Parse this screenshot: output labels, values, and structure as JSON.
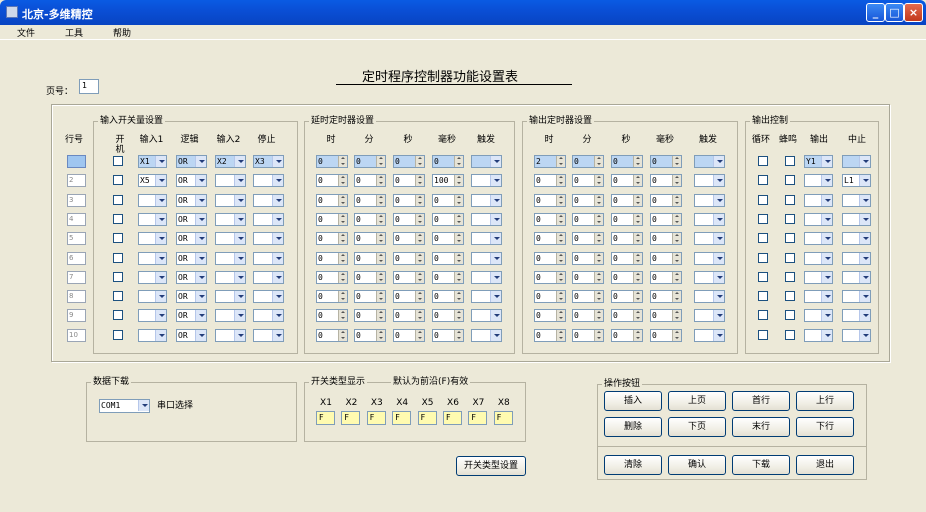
{
  "window": {
    "title": "北京-多维精控"
  },
  "menu": [
    "文件",
    "工具",
    "帮助"
  ],
  "page": {
    "label": "页号：",
    "value": "1"
  },
  "main_title": "定时程序控制器功能设置表",
  "sections": {
    "input_switch": "输入开关量设置",
    "delay_timer": "延时定时器设置",
    "output_timer": "输出定时器设置",
    "output_control": "输出控制"
  },
  "headers": {
    "row": "行号",
    "input": [
      "开机",
      "输入1",
      "逻辑",
      "输入2",
      "停止"
    ],
    "delay": [
      "时",
      "分",
      "秒",
      "毫秒",
      "触发"
    ],
    "output": [
      "时",
      "分",
      "秒",
      "毫秒",
      "触发"
    ],
    "control": [
      "循环",
      "蜂鸣",
      "输出",
      "中止"
    ]
  },
  "rows": [
    {
      "no": "1",
      "in1": "X1",
      "logic": "OR",
      "in2": "X2",
      "stop": "X3",
      "d": [
        "0",
        "0",
        "0",
        "0"
      ],
      "o": [
        "2",
        "0",
        "0",
        "0"
      ],
      "out": "Y1",
      "abort": ""
    },
    {
      "no": "2",
      "in1": "X5",
      "logic": "OR",
      "in2": "",
      "stop": "",
      "d": [
        "0",
        "0",
        "0",
        "100"
      ],
      "o": [
        "0",
        "0",
        "0",
        "0"
      ],
      "out": "",
      "abort": "L1"
    },
    {
      "no": "3",
      "in1": "",
      "logic": "OR",
      "in2": "",
      "stop": "",
      "d": [
        "0",
        "0",
        "0",
        "0"
      ],
      "o": [
        "0",
        "0",
        "0",
        "0"
      ],
      "out": "",
      "abort": ""
    },
    {
      "no": "4",
      "in1": "",
      "logic": "OR",
      "in2": "",
      "stop": "",
      "d": [
        "0",
        "0",
        "0",
        "0"
      ],
      "o": [
        "0",
        "0",
        "0",
        "0"
      ],
      "out": "",
      "abort": ""
    },
    {
      "no": "5",
      "in1": "",
      "logic": "OR",
      "in2": "",
      "stop": "",
      "d": [
        "0",
        "0",
        "0",
        "0"
      ],
      "o": [
        "0",
        "0",
        "0",
        "0"
      ],
      "out": "",
      "abort": ""
    },
    {
      "no": "6",
      "in1": "",
      "logic": "OR",
      "in2": "",
      "stop": "",
      "d": [
        "0",
        "0",
        "0",
        "0"
      ],
      "o": [
        "0",
        "0",
        "0",
        "0"
      ],
      "out": "",
      "abort": ""
    },
    {
      "no": "7",
      "in1": "",
      "logic": "OR",
      "in2": "",
      "stop": "",
      "d": [
        "0",
        "0",
        "0",
        "0"
      ],
      "o": [
        "0",
        "0",
        "0",
        "0"
      ],
      "out": "",
      "abort": ""
    },
    {
      "no": "8",
      "in1": "",
      "logic": "OR",
      "in2": "",
      "stop": "",
      "d": [
        "0",
        "0",
        "0",
        "0"
      ],
      "o": [
        "0",
        "0",
        "0",
        "0"
      ],
      "out": "",
      "abort": ""
    },
    {
      "no": "9",
      "in1": "",
      "logic": "OR",
      "in2": "",
      "stop": "",
      "d": [
        "0",
        "0",
        "0",
        "0"
      ],
      "o": [
        "0",
        "0",
        "0",
        "0"
      ],
      "out": "",
      "abort": ""
    },
    {
      "no": "10",
      "in1": "",
      "logic": "OR",
      "in2": "",
      "stop": "",
      "d": [
        "0",
        "0",
        "0",
        "0"
      ],
      "o": [
        "0",
        "0",
        "0",
        "0"
      ],
      "out": "",
      "abort": ""
    }
  ],
  "download": {
    "title": "数据下载",
    "port": "COM1",
    "port_label": "串口选择"
  },
  "switch_type": {
    "title": "开关类型显示",
    "note": "默认为前沿(F)有效",
    "labels": [
      "X1",
      "X2",
      "X3",
      "X4",
      "X5",
      "X6",
      "X7",
      "X8"
    ],
    "values": [
      "F",
      "F",
      "F",
      "F",
      "F",
      "F",
      "F",
      "F"
    ],
    "button": "开关类型设置"
  },
  "operations": {
    "title": "操作按钮",
    "row1": [
      "插入",
      "上页",
      "首行",
      "上行"
    ],
    "row2": [
      "删除",
      "下页",
      "末行",
      "下行"
    ],
    "row3": [
      "清除",
      "确认",
      "下载",
      "退出"
    ]
  },
  "colors": {
    "titlebar": "#0a5be3",
    "face": "#ece9d8",
    "highlight": "#bcd6f3",
    "yellow": "#fffbb0"
  }
}
